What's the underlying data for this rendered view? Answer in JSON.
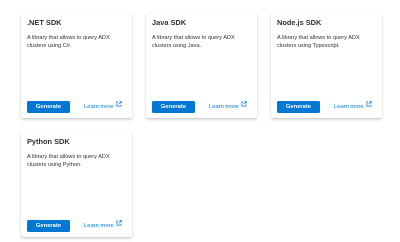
{
  "cards": [
    {
      "title": ".NET SDK",
      "description": "A library that allows to query ADX clusters using C#.",
      "generate_label": "Generate",
      "learn_more_label": "Learn more",
      "learn_more_icon": "external-link-icon"
    },
    {
      "title": "Java SDK",
      "description": "A library that allows to query ADX clusters using Java.",
      "generate_label": "Generate",
      "learn_more_label": "Learn more",
      "learn_more_icon": "external-link-icon"
    },
    {
      "title": "Node.js SDK",
      "description": "A library that allows to query ADX clusters using Typescript.",
      "generate_label": "Generate",
      "learn_more_label": "Learn more",
      "learn_more_icon": "external-link-icon"
    },
    {
      "title": "Python SDK",
      "description": "A library that allows to query ADX clusters using Python.",
      "generate_label": "Generate",
      "learn_more_label": "Learn more",
      "learn_more_icon": "external-link-icon"
    }
  ],
  "colors": {
    "accent": "#0078d4",
    "text": "#323130",
    "card_background": "#ffffff"
  }
}
